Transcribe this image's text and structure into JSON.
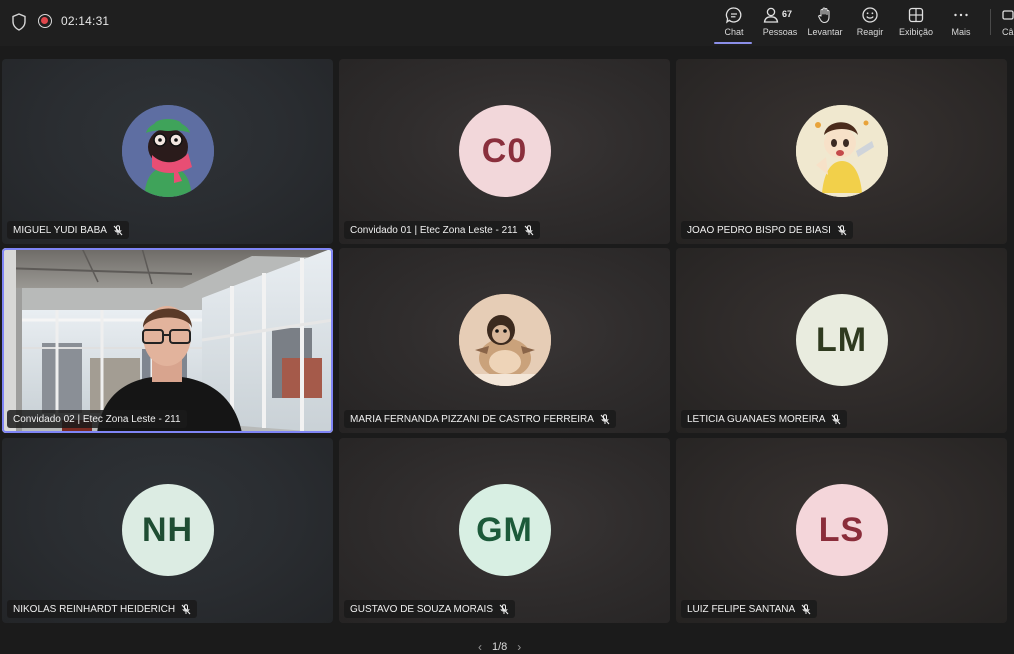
{
  "call": {
    "timer": "02:14:31"
  },
  "toolbar": {
    "items": [
      {
        "label": "Chat",
        "icon": "chat-icon"
      },
      {
        "label": "Pessoas",
        "count": "67",
        "icon": "people-icon"
      },
      {
        "label": "Levantar",
        "icon": "raise-hand-icon"
      },
      {
        "label": "Reagir",
        "icon": "smiley-icon"
      },
      {
        "label": "Exibição",
        "icon": "view-grid-icon"
      },
      {
        "label": "Mais",
        "icon": "more-icon"
      }
    ],
    "cut_label": "Câ"
  },
  "accent": "#8b8fe8",
  "participants": [
    {
      "name": "MIGUEL YUDI BABA",
      "avatar": "cartoon-avatar"
    },
    {
      "name": "Convidado 01 | Etec Zona Leste - 211",
      "initials": "C0",
      "bg": "#f2d7da",
      "fg": "#8a2f3c"
    },
    {
      "name": "JOAO PEDRO BISPO DE BIASI",
      "avatar": "anime-avatar"
    },
    {
      "name": "Convidado 02 | Etec Zona Leste - 211",
      "avatar": "video-feed"
    },
    {
      "name": "MARIA FERNANDA PIZZANI DE CASTRO FERREIRA",
      "avatar": "monkey-photo-avatar"
    },
    {
      "name": "LETICIA GUANAES MOREIRA",
      "initials": "LM",
      "bg": "#e9ecdf",
      "fg": "#2f3a1f"
    },
    {
      "name": "NIKOLAS REINHARDT HEIDERICH",
      "initials": "NH",
      "bg": "#dcece3",
      "fg": "#1f4d33"
    },
    {
      "name": "GUSTAVO DE SOUZA MORAIS",
      "initials": "GM",
      "bg": "#d8efe3",
      "fg": "#1c5a3a"
    },
    {
      "name": "LUIZ FELIPE SANTANA",
      "initials": "LS",
      "bg": "#f4d6da",
      "fg": "#8a2d3a"
    }
  ],
  "pager": {
    "text": "1/8"
  }
}
